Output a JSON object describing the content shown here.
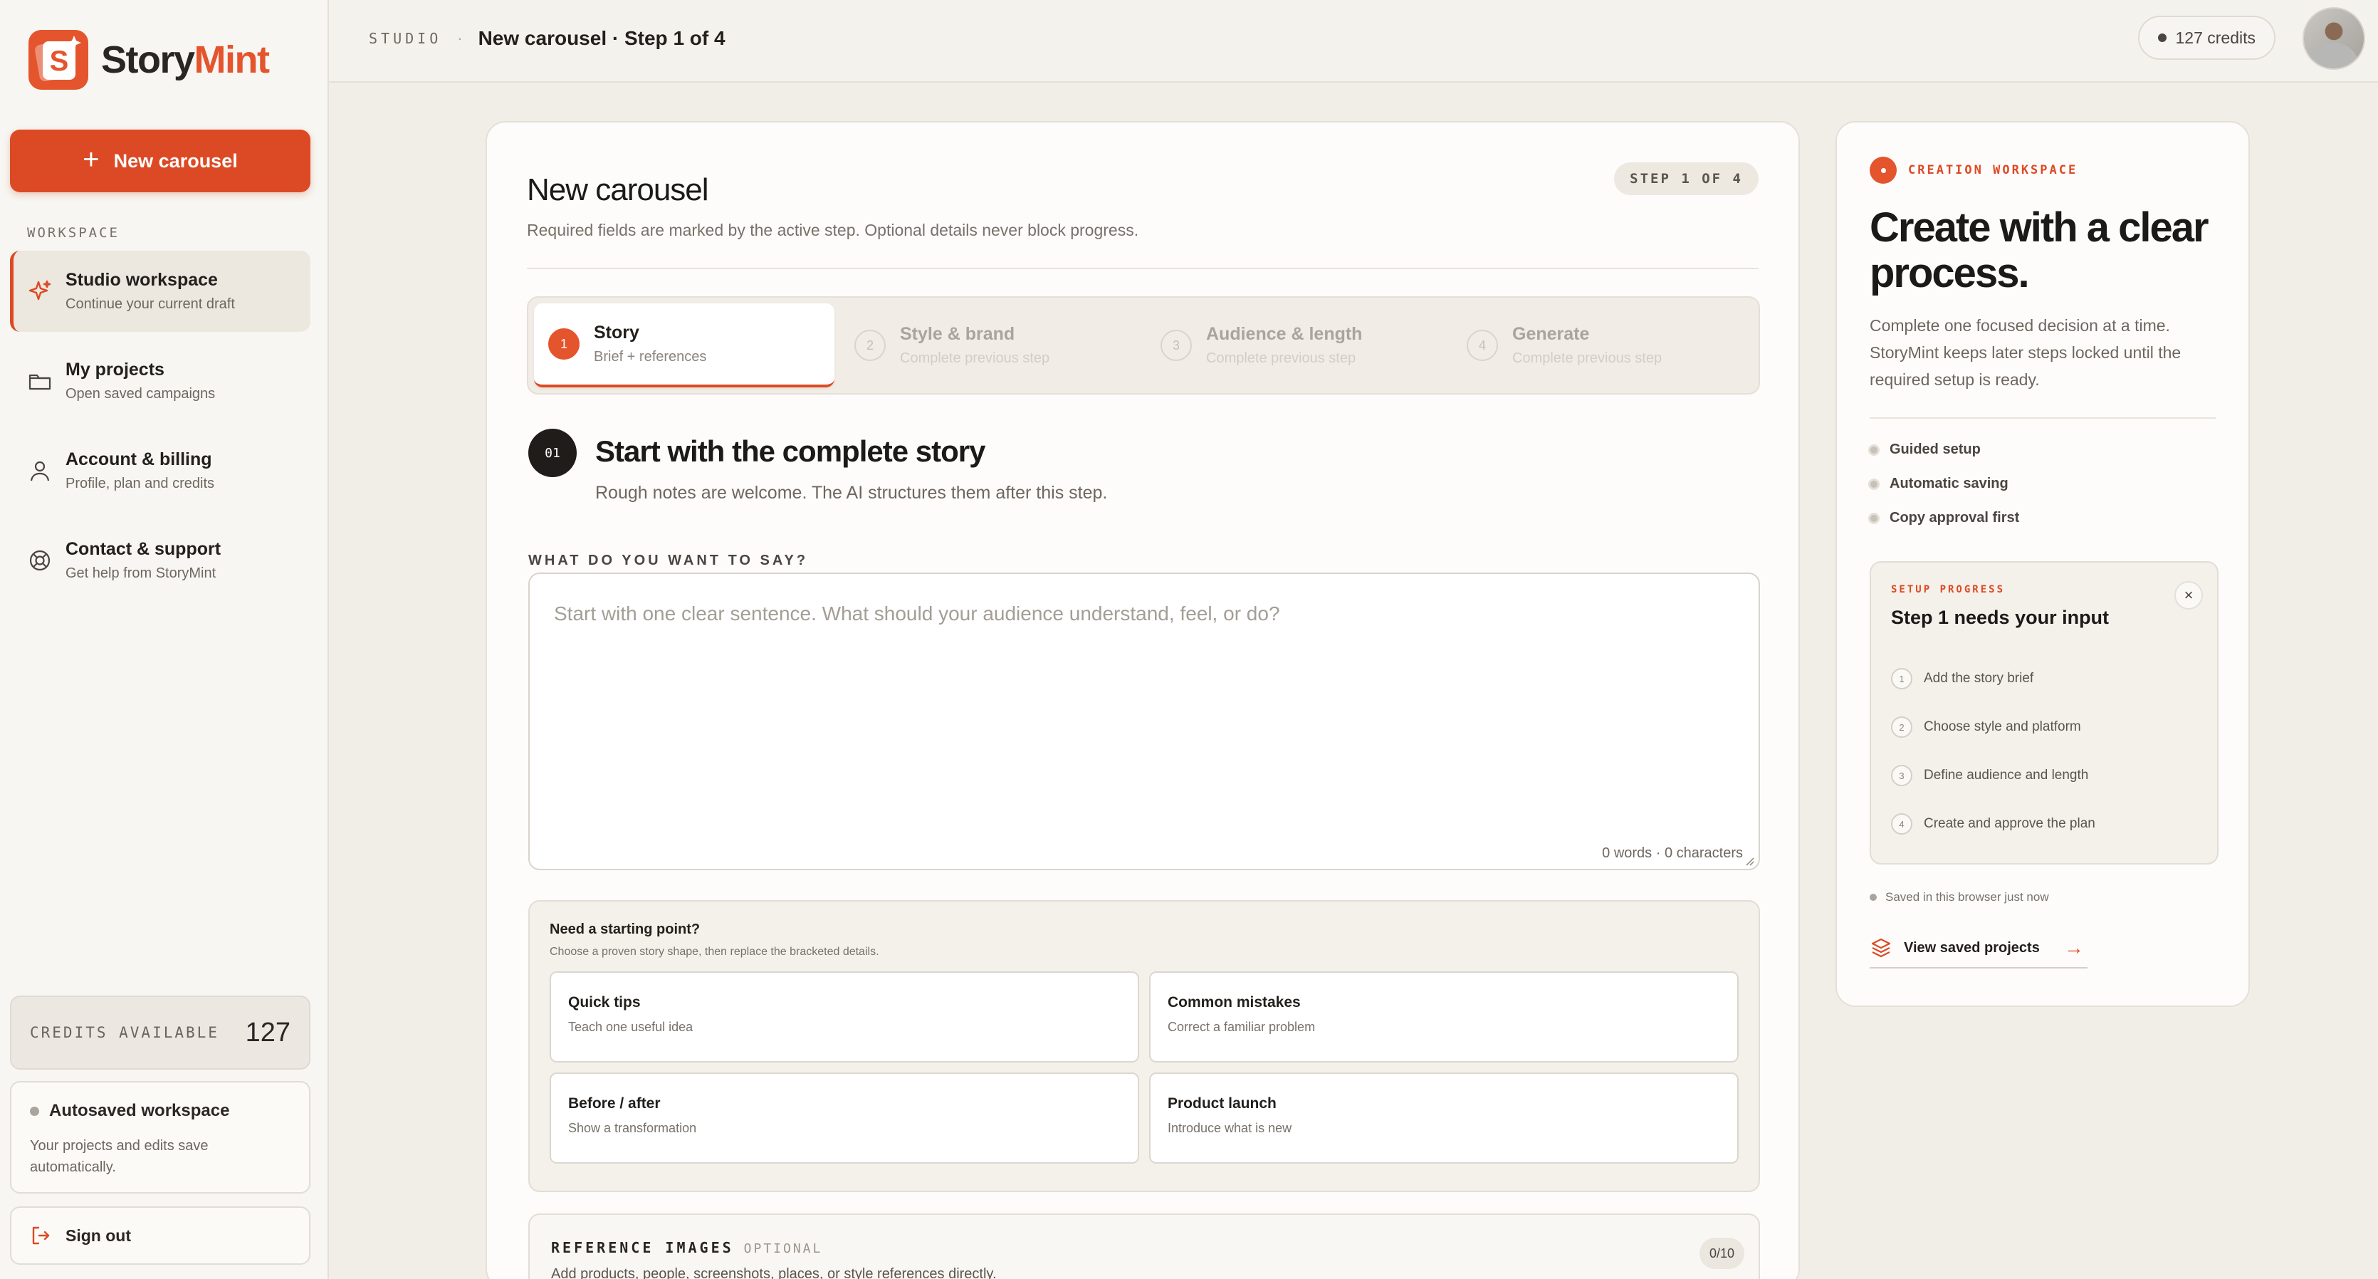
{
  "brand": {
    "name_part1": "Story",
    "name_part2": "Mint",
    "accent": "#dc4a25"
  },
  "sidebar": {
    "new_button": "New carousel",
    "section_label": "WORKSPACE",
    "items": [
      {
        "title": "Studio workspace",
        "subtitle": "Continue your current draft",
        "icon": "sparkle-icon",
        "active": true
      },
      {
        "title": "My projects",
        "subtitle": "Open saved campaigns",
        "icon": "folder-icon"
      },
      {
        "title": "Account & billing",
        "subtitle": "Profile, plan and credits",
        "icon": "user-icon"
      },
      {
        "title": "Contact & support",
        "subtitle": "Get help from StoryMint",
        "icon": "lifebuoy-icon"
      }
    ],
    "credits_label": "CREDITS AVAILABLE",
    "credits_value": "127",
    "autosave_title": "Autosaved workspace",
    "autosave_desc": "Your projects and edits save automatically.",
    "signout": "Sign out"
  },
  "topbar": {
    "section": "STUDIO",
    "separator": "·",
    "current": "New carousel · Step 1 of 4",
    "credits": "127 credits"
  },
  "main": {
    "title": "New carousel",
    "description": "Required fields are marked by the active step. Optional details never block progress.",
    "step_pill": "STEP 1 OF 4",
    "steps": [
      {
        "num": "1",
        "title": "Story",
        "sub": "Brief + references",
        "active": true
      },
      {
        "num": "2",
        "title": "Style & brand",
        "sub": "Complete previous step"
      },
      {
        "num": "3",
        "title": "Audience & length",
        "sub": "Complete previous step"
      },
      {
        "num": "4",
        "title": "Generate",
        "sub": "Complete previous step"
      }
    ],
    "section_badge": "01",
    "section_title": "Start with the complete story",
    "section_desc": "Rough notes are welcome. The AI structures them after this step.",
    "field_label": "WHAT DO YOU WANT TO SAY?",
    "story_placeholder": "Start with one clear sentence. What should your audience understand, feel, or do?",
    "story_count": "0 words · 0 characters",
    "starter_title": "Need a starting point?",
    "starter_desc": "Choose a proven story shape, then replace the bracketed details.",
    "templates": [
      {
        "title": "Quick tips",
        "desc": "Teach one useful idea"
      },
      {
        "title": "Common mistakes",
        "desc": "Correct a familiar problem"
      },
      {
        "title": "Before / after",
        "desc": "Show a transformation"
      },
      {
        "title": "Product launch",
        "desc": "Introduce what is new"
      }
    ],
    "refs_title": "REFERENCE IMAGES",
    "refs_optional": "OPTIONAL",
    "refs_desc": "Add products, people, screenshots, places, or style references directly.",
    "refs_count": "0/10"
  },
  "side": {
    "kicker": "CREATION WORKSPACE",
    "title": "Create with a clear process.",
    "desc": "Complete one focused decision at a time. StoryMint keeps later steps locked until the required setup is ready.",
    "features": [
      "Guided setup",
      "Automatic saving",
      "Copy approval first"
    ],
    "progress_kicker": "SETUP PROGRESS",
    "progress_title": "Step 1 needs your input",
    "progress_close": "×",
    "progress_steps": [
      {
        "num": "1",
        "label": "Add the story brief"
      },
      {
        "num": "2",
        "label": "Choose style and platform"
      },
      {
        "num": "3",
        "label": "Define audience and length"
      },
      {
        "num": "4",
        "label": "Create and approve the plan"
      }
    ],
    "saved_note": "Saved in this browser just now",
    "view_saved": "View saved projects",
    "arrow": "→"
  }
}
